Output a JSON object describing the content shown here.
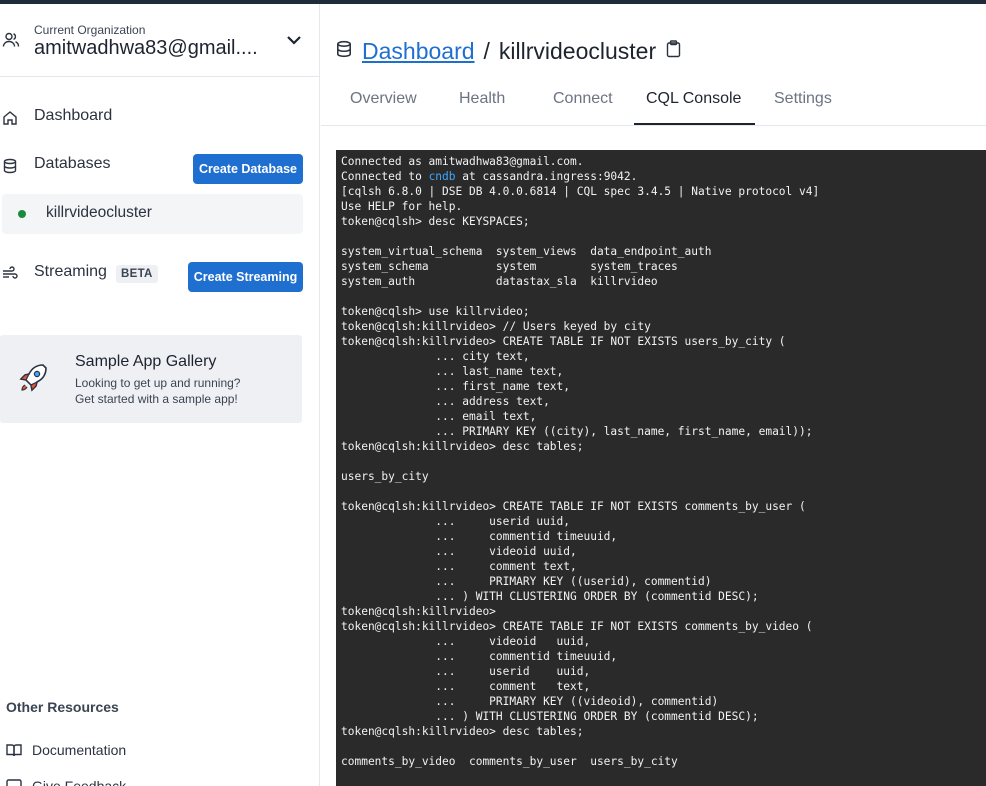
{
  "org": {
    "label": "Current Organization",
    "email": "amitwadhwa83@gmail...."
  },
  "nav": {
    "dashboard": "Dashboard",
    "databases": "Databases",
    "create_database": "Create Database",
    "db_item": "killrvideocluster",
    "streaming": "Streaming",
    "beta": "BETA",
    "create_streaming": "Create Streaming"
  },
  "gallery": {
    "title": "Sample App Gallery",
    "line1": "Looking to get up and running?",
    "line2": "Get started with a sample app!"
  },
  "resources": {
    "title": "Other Resources",
    "documentation": "Documentation",
    "feedback": "Give Feedback"
  },
  "breadcrumb": {
    "root": "Dashboard",
    "separator": "/",
    "current": "killrvideocluster"
  },
  "tabs": [
    "Overview",
    "Health",
    "Connect",
    "CQL Console",
    "Settings"
  ],
  "console": {
    "connected_prefix": "Connected as amitwadhwa83@gmail.com.",
    "connected2_a": "Connected to ",
    "connected2_hl": "cndb",
    "connected2_b": " at cassandra.ingress:9042.",
    "lines": [
      "[cqlsh 6.8.0 | DSE DB 4.0.0.6814 | CQL spec 3.4.5 | Native protocol v4]",
      "Use HELP for help.",
      "token@cqlsh> desc KEYSPACES;",
      "",
      "system_virtual_schema  system_views  data_endpoint_auth",
      "system_schema          system        system_traces",
      "system_auth            datastax_sla  killrvideo",
      "",
      "token@cqlsh> use killrvideo;",
      "token@cqlsh:killrvideo> // Users keyed by city",
      "token@cqlsh:killrvideo> CREATE TABLE IF NOT EXISTS users_by_city (",
      "              ... city text,",
      "              ... last_name text,",
      "              ... first_name text,",
      "              ... address text,",
      "              ... email text,",
      "              ... PRIMARY KEY ((city), last_name, first_name, email));",
      "token@cqlsh:killrvideo> desc tables;",
      "",
      "users_by_city",
      "",
      "token@cqlsh:killrvideo> CREATE TABLE IF NOT EXISTS comments_by_user (",
      "              ...     userid uuid,",
      "              ...     commentid timeuuid,",
      "              ...     videoid uuid,",
      "              ...     comment text,",
      "              ...     PRIMARY KEY ((userid), commentid)",
      "              ... ) WITH CLUSTERING ORDER BY (commentid DESC);",
      "token@cqlsh:killrvideo>",
      "token@cqlsh:killrvideo> CREATE TABLE IF NOT EXISTS comments_by_video (",
      "              ...     videoid   uuid,",
      "              ...     commentid timeuuid,",
      "              ...     userid    uuid,",
      "              ...     comment   text,",
      "              ...     PRIMARY KEY ((videoid), commentid)",
      "              ... ) WITH CLUSTERING ORDER BY (commentid DESC);",
      "token@cqlsh:killrvideo> desc tables;",
      "",
      "comments_by_video  comments_by_user  users_by_city"
    ]
  },
  "colors": {
    "accent": "#1f6fd1",
    "console_bg": "#2a2a2a",
    "status_green": "#1a8a3c"
  }
}
